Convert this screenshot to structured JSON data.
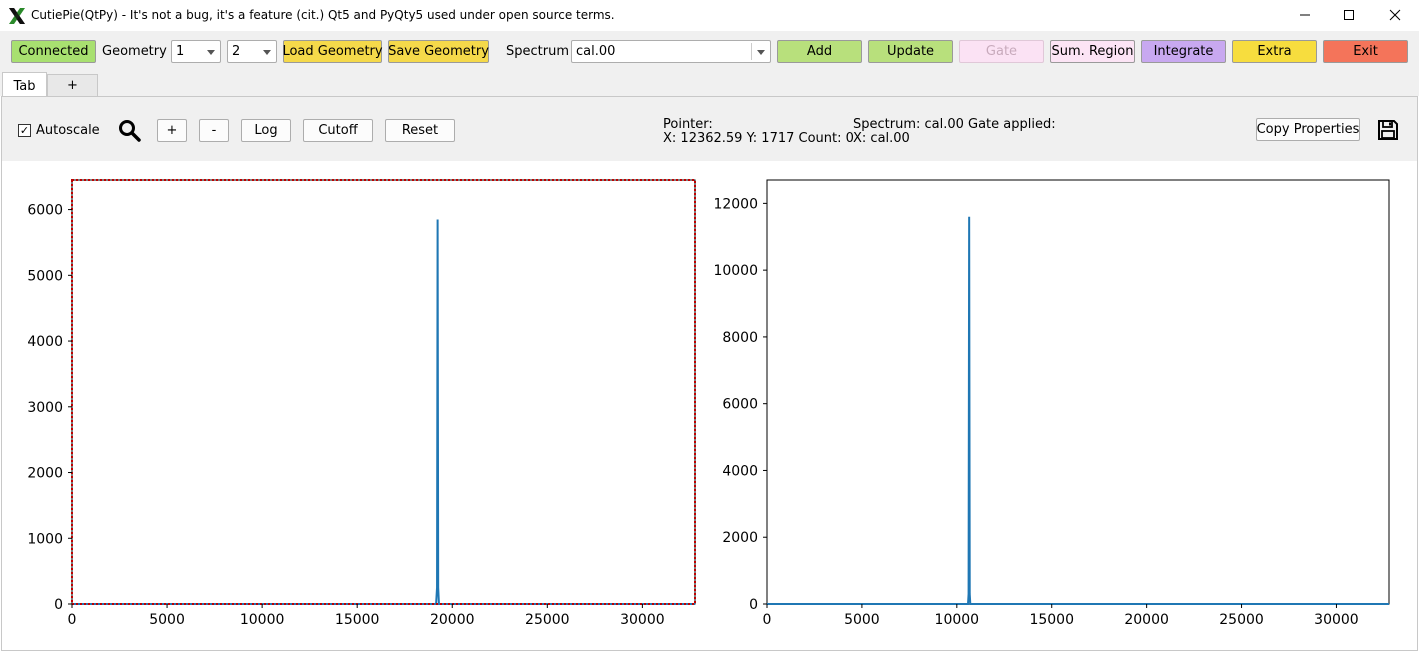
{
  "window": {
    "title": "CutiePie(QtPy) - It's not a bug, it's a feature (cit.) Qt5 and PyQty5 used under open source terms."
  },
  "toolbar": {
    "connected_label": "Connected",
    "geometry_label": "Geometry",
    "geometry_rows": "1",
    "geometry_cols": "2",
    "load_geometry_label": "Load Geometry",
    "save_geometry_label": "Save Geometry",
    "spectrum_label": "Spectrum",
    "spectrum_value": "cal.00",
    "add_label": "Add",
    "update_label": "Update",
    "gate_label": "Gate",
    "sum_region_label": "Sum. Region",
    "integrate_label": "Integrate",
    "extra_label": "Extra",
    "exit_label": "Exit",
    "colors": {
      "connected": "#a8e070",
      "load_save": "#f5d94a",
      "add_update": "#b8e07c",
      "gate": "#fbe2f4",
      "sum_region": "#fce4f5",
      "integrate": "#c8a8f0",
      "extra": "#f7dd3e",
      "exit": "#f4745a"
    }
  },
  "tabs": [
    {
      "label": "Tab"
    },
    {
      "label": "+"
    }
  ],
  "controls": {
    "autoscale_label": "Autoscale",
    "autoscale_checked": "✓",
    "zoom_in_label": "+",
    "zoom_out_label": "-",
    "log_label": "Log",
    "cutoff_label": "Cutoff",
    "reset_label": "Reset",
    "pointer_label": "Pointer:",
    "pointer_value": "X: 12362.59 Y: 1717 Count: 0",
    "spectrum_info": "Spectrum: cal.00",
    "spectrum_x": "X: cal.00",
    "gate_applied_label": "Gate applied:",
    "copy_properties_label": "Copy Properties"
  },
  "chart_data": [
    {
      "type": "line",
      "title": "",
      "xlabel": "",
      "ylabel": "",
      "xlim": [
        0,
        32768
      ],
      "ylim": [
        0,
        6450
      ],
      "xticks": [
        0,
        5000,
        10000,
        15000,
        20000,
        25000,
        30000
      ],
      "yticks": [
        0,
        1000,
        2000,
        3000,
        4000,
        5000,
        6000
      ],
      "xtick_labels": [
        "0",
        "5000",
        "10000",
        "15000",
        "20000",
        "25000",
        "30000"
      ],
      "ytick_labels": [
        "0",
        "1000",
        "2000",
        "3000",
        "4000",
        "5000",
        "6000"
      ],
      "series": [
        {
          "color": "#1f77b4",
          "x": [
            0,
            19150,
            19200,
            19230,
            19260,
            19300,
            32768
          ],
          "y": [
            0,
            0,
            250,
            5850,
            250,
            0,
            0
          ]
        }
      ],
      "selected": true,
      "selected_color": "#c00000"
    },
    {
      "type": "line",
      "title": "",
      "xlabel": "",
      "ylabel": "",
      "xlim": [
        0,
        32768
      ],
      "ylim": [
        0,
        12700
      ],
      "xticks": [
        0,
        5000,
        10000,
        15000,
        20000,
        25000,
        30000
      ],
      "yticks": [
        0,
        2000,
        4000,
        6000,
        8000,
        10000,
        12000
      ],
      "xtick_labels": [
        "0",
        "5000",
        "10000",
        "15000",
        "20000",
        "25000",
        "30000"
      ],
      "ytick_labels": [
        "0",
        "2000",
        "4000",
        "6000",
        "8000",
        "10000",
        "12000"
      ],
      "series": [
        {
          "color": "#1f77b4",
          "x": [
            0,
            10590,
            10620,
            10650,
            10680,
            10710,
            32768
          ],
          "y": [
            0,
            0,
            300,
            11600,
            300,
            0,
            0
          ]
        }
      ],
      "selected": false
    }
  ]
}
